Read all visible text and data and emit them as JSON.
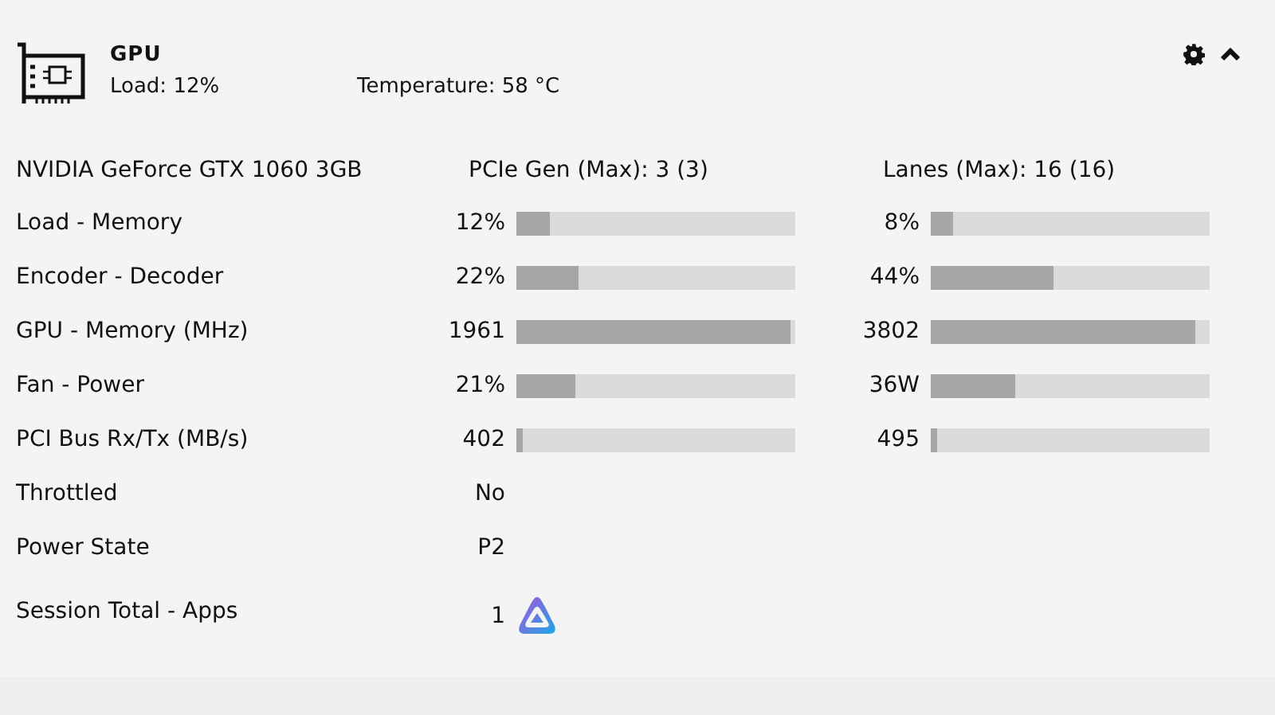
{
  "card": {
    "title": "GPU",
    "load": "Load: 12%",
    "temperature": "Temperature: 58 °C"
  },
  "device": {
    "name": "NVIDIA GeForce GTX 1060 3GB",
    "pcie": "PCIe Gen (Max): 3 (3)",
    "lanes": "Lanes (Max): 16 (16)"
  },
  "rows": [
    {
      "kind": "bars",
      "label": "Load - Memory",
      "meters": [
        {
          "value": "12%",
          "level": 0.12
        },
        {
          "value": "8%",
          "level": 0.08
        }
      ]
    },
    {
      "kind": "bars",
      "label": "Encoder - Decoder",
      "meters": [
        {
          "value": "22%",
          "level": 0.22
        },
        {
          "value": "44%",
          "level": 0.44
        }
      ]
    },
    {
      "kind": "bars",
      "label": "GPU - Memory (MHz)",
      "meters": [
        {
          "value": "1961",
          "level": 0.98
        },
        {
          "value": "3802",
          "level": 0.95
        }
      ]
    },
    {
      "kind": "bars",
      "label": "Fan - Power",
      "meters": [
        {
          "value": "21%",
          "level": 0.21
        },
        {
          "value": "36W",
          "level": 0.3
        }
      ]
    },
    {
      "kind": "bars",
      "label": "PCI Bus Rx/Tx (MB/s)",
      "meters": [
        {
          "value": "402",
          "level": 0.02
        },
        {
          "value": "495",
          "level": 0.02
        }
      ]
    },
    {
      "kind": "text",
      "label": "Throttled",
      "value": "No"
    },
    {
      "kind": "text",
      "label": "Power State",
      "value": "P2"
    },
    {
      "kind": "apps",
      "label": "Session Total - Apps",
      "value": "1"
    }
  ]
}
